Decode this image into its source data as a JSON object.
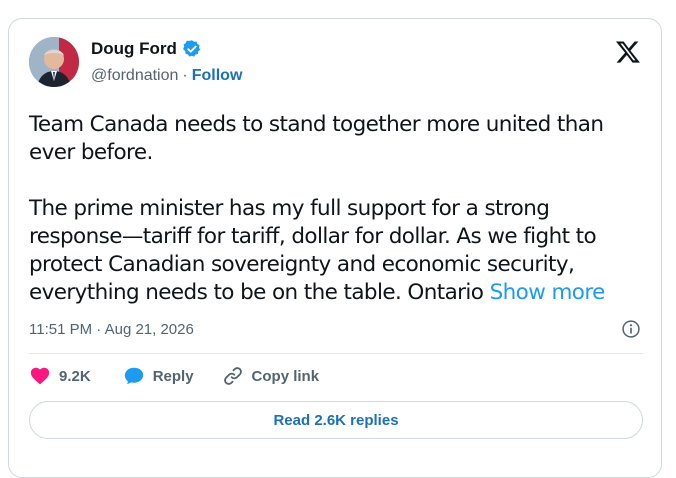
{
  "author": {
    "name": "Doug Ford",
    "handle": "@fordnation",
    "separator": "·",
    "follow_label": "Follow",
    "verified": true
  },
  "tweet": {
    "text": "Team Canada needs to stand together more united than ever before.\n\nThe prime minister has my full support for a strong response—tariff for tariff, dollar for dollar. As we fight to protect Canadian sovereignty and economic security, everything needs to be on the table. Ontario ",
    "show_more_label": "Show more",
    "timestamp": "11:51 PM · Aug 21, 2026"
  },
  "actions": {
    "like_count": "9.2K",
    "reply_label": "Reply",
    "copy_link_label": "Copy link"
  },
  "read_replies_label": "Read 2.6K replies",
  "colors": {
    "accent": "#1d9bf0",
    "link_dark": "#1d70b8",
    "like": "#f91880",
    "muted": "#536471",
    "border": "#cfd9de"
  },
  "icons": {
    "brand": "x-logo-icon",
    "verified": "verified-badge-icon",
    "info": "info-icon",
    "like": "heart-icon",
    "reply": "speech-bubble-icon",
    "copy_link": "link-icon"
  }
}
